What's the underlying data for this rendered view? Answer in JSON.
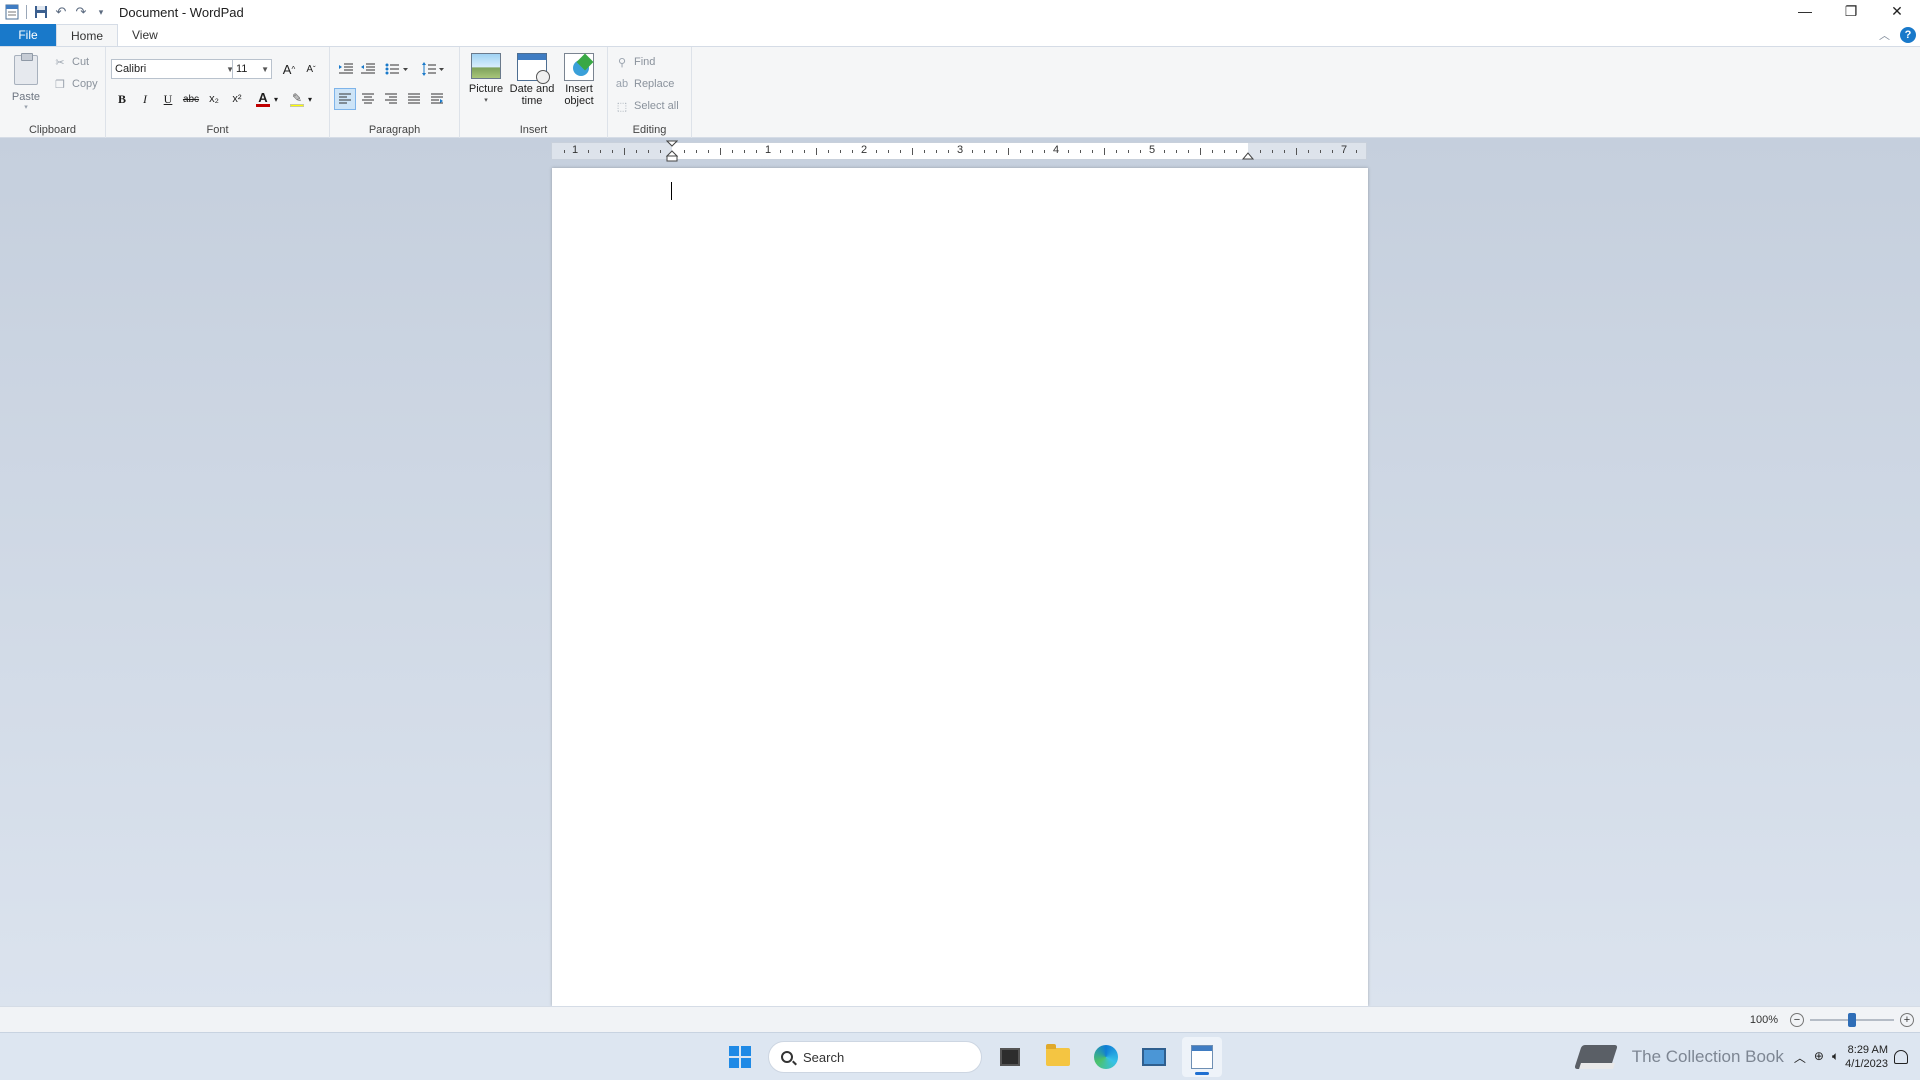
{
  "window": {
    "title": "Document - WordPad",
    "minimize_glyph": "—",
    "restore_glyph": "❐",
    "close_glyph": "✕"
  },
  "quick_access": [
    "save-icon",
    "undo-icon",
    "redo-icon",
    "customize-icon"
  ],
  "tabs": {
    "file": "File",
    "home": "Home",
    "view": "View"
  },
  "clipboard": {
    "paste": "Paste",
    "cut": "Cut",
    "copy": "Copy",
    "label": "Clipboard"
  },
  "font": {
    "family": "Calibri",
    "size": "11",
    "label": "Font",
    "bold": "B",
    "italic": "I",
    "underline": "U",
    "strikethrough": "abc",
    "subscript": "x₂",
    "superscript": "x²",
    "color_letter": "A"
  },
  "paragraph": {
    "label": "Paragraph"
  },
  "insert": {
    "picture": "Picture",
    "date_time_1": "Date and",
    "date_time_2": "time",
    "object_1": "Insert",
    "object_2": "object",
    "label": "Insert"
  },
  "editing": {
    "find": "Find",
    "replace": "Replace",
    "select_all": "Select all",
    "label": "Editing"
  },
  "ruler": {
    "numbers": [
      "1",
      "1",
      "2",
      "3",
      "4",
      "5",
      "7"
    ]
  },
  "status": {
    "zoom": "100%",
    "zoom_minus": "−",
    "zoom_plus": "+",
    "zoom_level": 0.5
  },
  "taskbar": {
    "search_placeholder": "Search",
    "watermark": "The Collection Book",
    "time": "8:29 AM",
    "date": "4/1/2023"
  },
  "colors": {
    "accent": "#1979ca",
    "font_color_bar": "#c00000",
    "highlight_bar": "#ffff00"
  }
}
